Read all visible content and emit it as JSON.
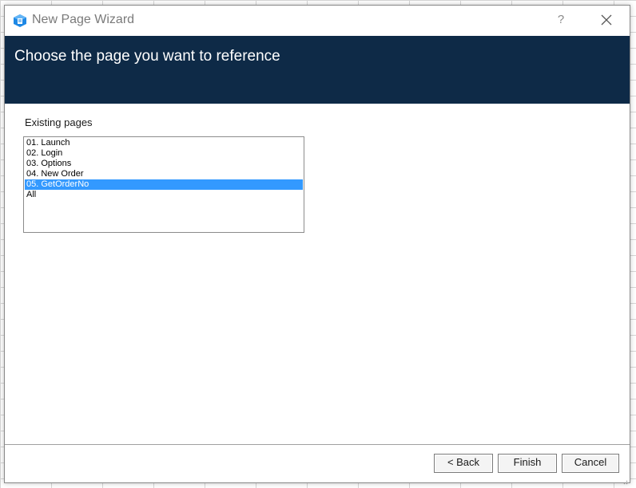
{
  "window": {
    "title": "New Page Wizard",
    "help_symbol": "?",
    "icon": "wizard-app-icon"
  },
  "header": {
    "title": "Choose the page you want to reference",
    "background_color": "#0e2a47"
  },
  "existing_pages": {
    "label": "Existing pages",
    "items": [
      {
        "label": "01. Launch",
        "selected": false
      },
      {
        "label": "02. Login",
        "selected": false
      },
      {
        "label": "03. Options",
        "selected": false
      },
      {
        "label": "04. New Order",
        "selected": false
      },
      {
        "label": "05. GetOrderNo",
        "selected": true
      },
      {
        "label": "All",
        "selected": false
      }
    ],
    "selection_color": "#3399ff"
  },
  "buttons": {
    "back": "< Back",
    "finish": "Finish",
    "cancel": "Cancel"
  }
}
